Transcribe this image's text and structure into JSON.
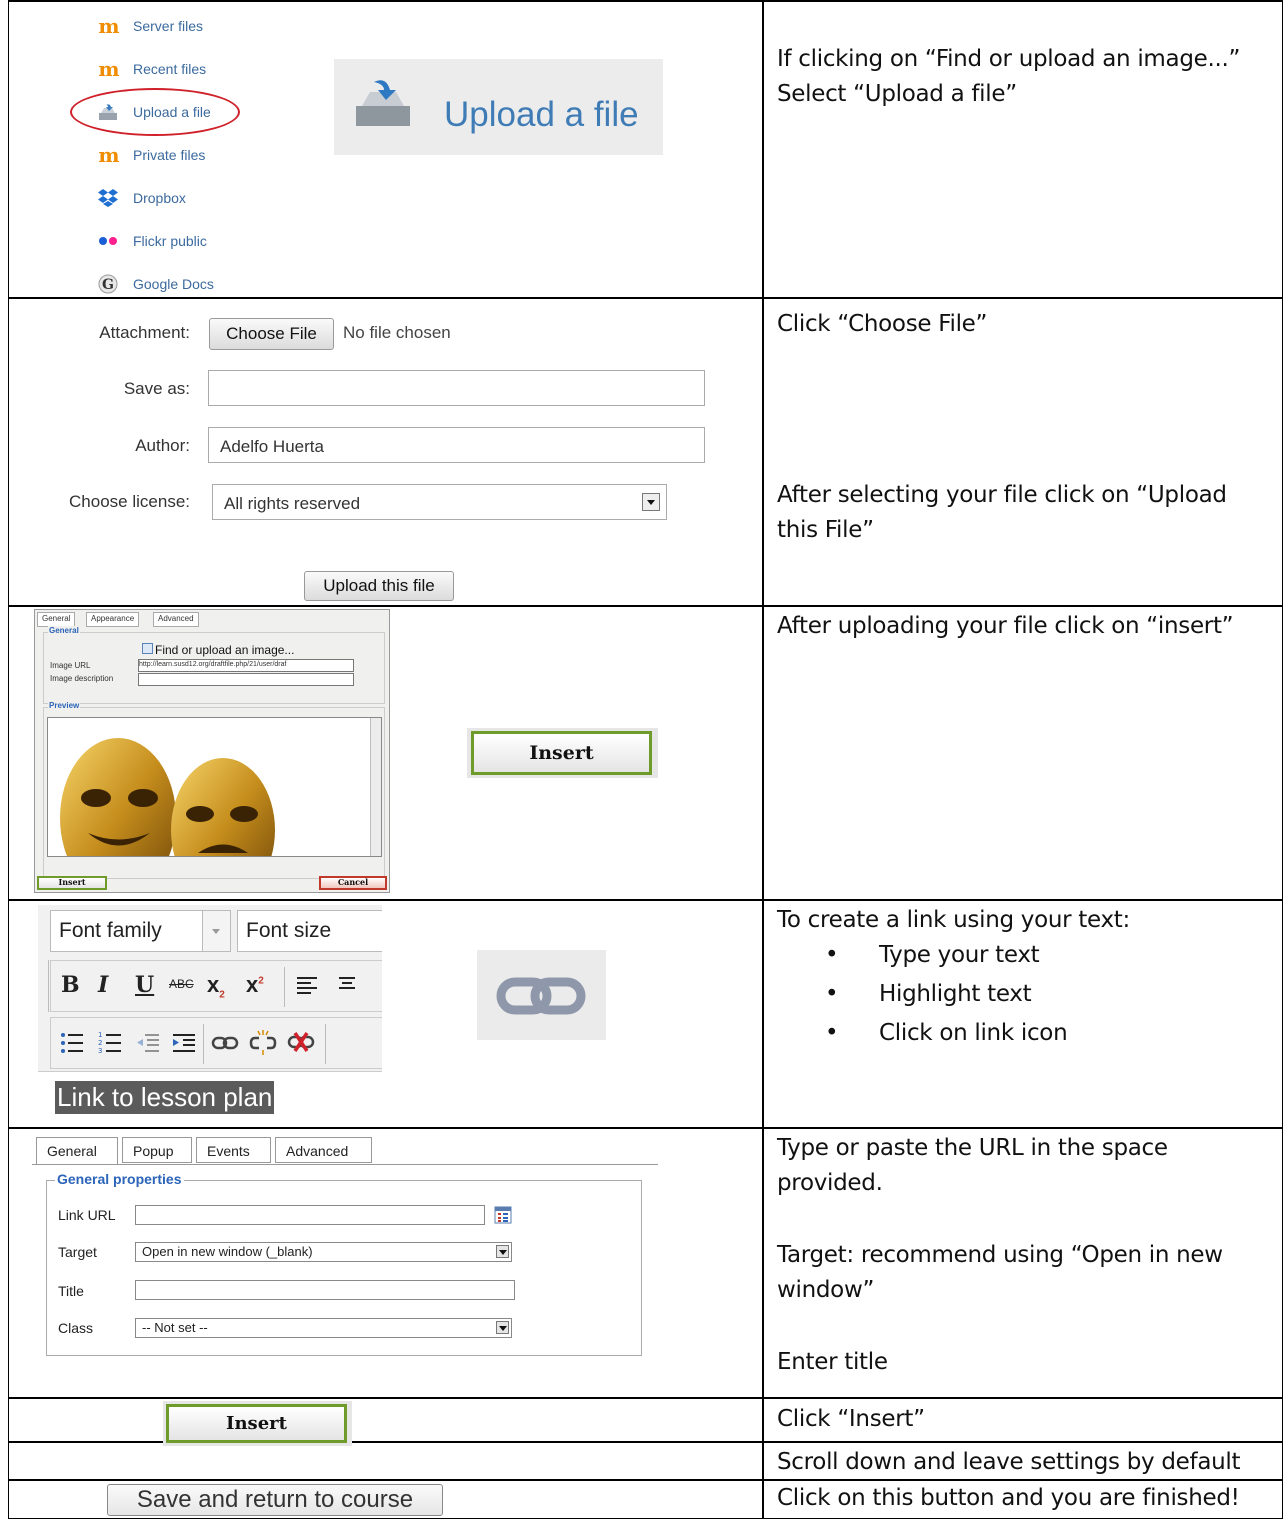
{
  "row1": {
    "file_picker_items": [
      {
        "label": "Server files",
        "icon": "moodle-icon"
      },
      {
        "label": "Recent files",
        "icon": "moodle-icon"
      },
      {
        "label": "Upload a file",
        "icon": "upload-icon"
      },
      {
        "label": "Private files",
        "icon": "moodle-icon"
      },
      {
        "label": "Dropbox",
        "icon": "dropbox-icon"
      },
      {
        "label": "Flickr public",
        "icon": "flickr-icon"
      },
      {
        "label": "Google Docs",
        "icon": "google-icon"
      }
    ],
    "upload_big_label": "Upload a file",
    "instruction_lines": [
      "If clicking on “Find or upload an image...”",
      "Select “Upload a file”"
    ]
  },
  "row2": {
    "attachment_label": "Attachment:",
    "choose_file_label": "Choose File",
    "no_file_text": "No file chosen",
    "save_as_label": "Save as:",
    "save_as_value": "",
    "author_label": "Author:",
    "author_value": "Adelfo Huerta",
    "license_label": "Choose license:",
    "license_value": "All rights reserved",
    "upload_button": "Upload this file",
    "instruction_1": "Click “Choose File”",
    "instruction_2": "After selecting your file click on “Upload this File”"
  },
  "row3": {
    "tabs": [
      "General",
      "Appearance",
      "Advanced"
    ],
    "general_legend": "General",
    "find_upload_label": "Find or upload an image...",
    "image_url_label": "Image URL",
    "image_url_value": "http://learn.susd12.org/draftfile.php/21/user/draf",
    "image_desc_label": "Image description",
    "preview_legend": "Preview",
    "insert_small": "Insert",
    "cancel_small": "Cancel",
    "insert_big": "Insert",
    "instruction": "After uploading your file click on “insert”"
  },
  "row4": {
    "font_family": "Font family",
    "font_size": "Font size",
    "highlighted_text": "Link to lesson plan",
    "instruction_title": "To create a link using your text:",
    "bullets": [
      "Type your text",
      "Highlight text",
      "Click on link icon"
    ]
  },
  "row5": {
    "tabs": [
      "General",
      "Popup",
      "Events",
      "Advanced"
    ],
    "legend": "General properties",
    "link_url_label": "Link URL",
    "target_label": "Target",
    "target_value": "Open in new window (_blank)",
    "title_label": "Title",
    "class_label": "Class",
    "class_value": "-- Not set --",
    "instruction_1": "Type or paste the URL in the space provided.",
    "instruction_2": "Target: recommend using “Open in new window”",
    "instruction_3": "Enter title"
  },
  "row6": {
    "insert_label": "Insert",
    "instruction": "Click “Insert”"
  },
  "row7": {
    "instruction": "Scroll down and leave settings by default"
  },
  "row8": {
    "save_return_label": "Save and return to course",
    "instruction": "Click on this button and you are finished!"
  }
}
